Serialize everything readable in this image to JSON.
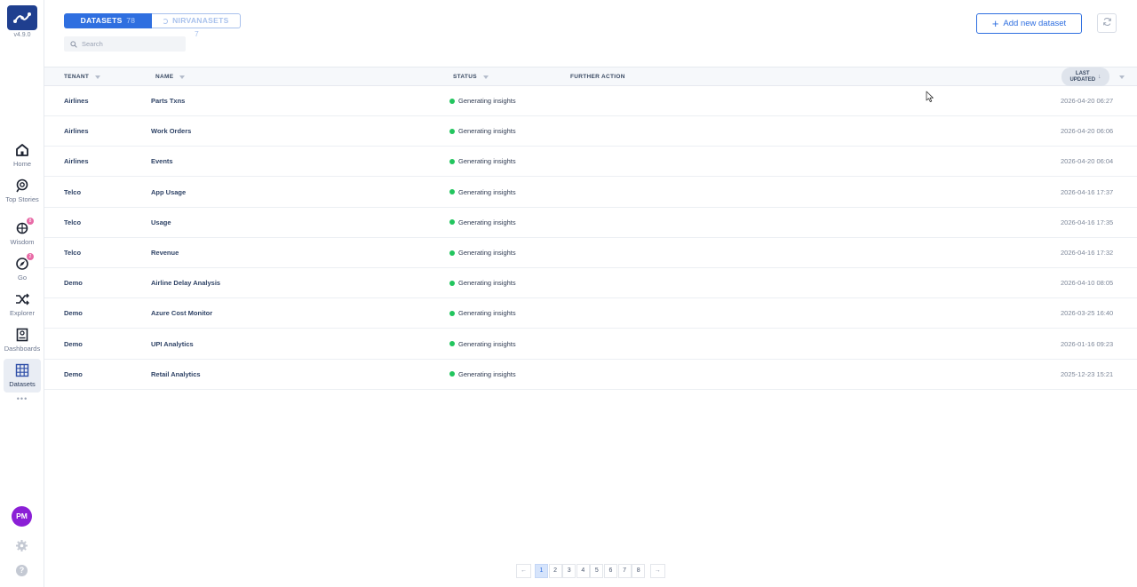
{
  "app": {
    "version": "v4.9.0"
  },
  "sidebar": {
    "items": [
      {
        "label": "Home",
        "icon": "home-icon"
      },
      {
        "label": "Top Stories",
        "icon": "top-stories-icon"
      },
      {
        "label": "Wisdom",
        "icon": "wisdom-icon",
        "badge": "8"
      },
      {
        "label": "Go",
        "icon": "go-icon",
        "badge": "2"
      },
      {
        "label": "Explorer",
        "icon": "explorer-icon"
      },
      {
        "label": "Dashboards",
        "icon": "dashboards-icon"
      },
      {
        "label": "Datasets",
        "icon": "datasets-icon",
        "active": true
      }
    ],
    "more": "•••",
    "user_initials": "PM",
    "help": "?"
  },
  "header": {
    "tabs": [
      {
        "label": "DATASETS",
        "count": "78",
        "active": true
      },
      {
        "label": "NIRVANASETS",
        "count": "7",
        "active": false
      }
    ],
    "search": {
      "placeholder": "Search",
      "value": ""
    },
    "add_button": "Add new dataset"
  },
  "table": {
    "columns": {
      "tenant": "TENANT",
      "name": "NAME",
      "status": "STATUS",
      "further_action": "FURTHER ACTION",
      "last_updated_1": "LAST",
      "last_updated_2": "UPDATED"
    },
    "rows": [
      {
        "tenant": "Airlines",
        "name": "Parts Txns",
        "status": "Generating insights",
        "updated": "2026-04-20 06:27"
      },
      {
        "tenant": "Airlines",
        "name": "Work Orders",
        "status": "Generating insights",
        "updated": "2026-04-20 06:06"
      },
      {
        "tenant": "Airlines",
        "name": "Events",
        "status": "Generating insights",
        "updated": "2026-04-20 06:04"
      },
      {
        "tenant": "Telco",
        "name": "App Usage",
        "status": "Generating insights",
        "updated": "2026-04-16 17:37"
      },
      {
        "tenant": "Telco",
        "name": "Usage",
        "status": "Generating insights",
        "updated": "2026-04-16 17:35"
      },
      {
        "tenant": "Telco",
        "name": "Revenue",
        "status": "Generating insights",
        "updated": "2026-04-16 17:32"
      },
      {
        "tenant": "Demo",
        "name": "Airline Delay Analysis",
        "status": "Generating insights",
        "updated": "2026-04-10 08:05"
      },
      {
        "tenant": "Demo",
        "name": "Azure Cost Monitor",
        "status": "Generating insights",
        "updated": "2026-03-25 16:40"
      },
      {
        "tenant": "Demo",
        "name": "UPI Analytics",
        "status": "Generating insights",
        "updated": "2026-01-16 09:23"
      },
      {
        "tenant": "Demo",
        "name": "Retail Analytics",
        "status": "Generating insights",
        "updated": "2025-12-23 15:21"
      }
    ]
  },
  "pagination": {
    "prev": "←",
    "next": "→",
    "pages": [
      "1",
      "2",
      "3",
      "4",
      "5",
      "6",
      "7",
      "8"
    ],
    "current": "1"
  },
  "colors": {
    "accent": "#2f6fe0",
    "status_ok": "#22c55e",
    "logo_bg": "#1f3f8f",
    "avatar_bg": "#8b1fd6"
  }
}
